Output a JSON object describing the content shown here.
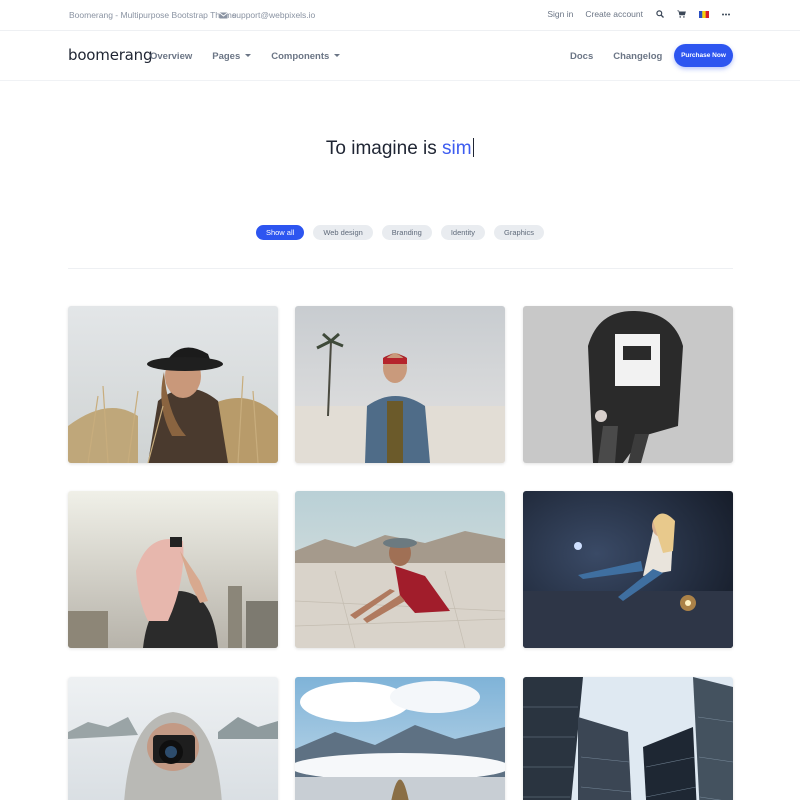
{
  "topbar": {
    "title": "Boomerang - Multipurpose Bootstrap Theme",
    "email": "support@webpixels.io",
    "sign_in": "Sign in",
    "create_account": "Create account",
    "icons": [
      "envelope-icon",
      "search-icon",
      "cart-icon",
      "flag-icon",
      "more-icon"
    ]
  },
  "navbar": {
    "brand": "boomerang",
    "left_items": [
      "Overview",
      "Pages",
      "Components"
    ],
    "right_items": [
      "Docs",
      "Changelog"
    ],
    "purchase_label": "Purchase Now",
    "accent_color": "#2d55f0"
  },
  "hero": {
    "text_prefix": "To imagine is ",
    "text_typed": "sim"
  },
  "filters": {
    "items": [
      "Show all",
      "Web design",
      "Branding",
      "Identity",
      "Graphics"
    ],
    "active": "Show all"
  },
  "gallery": {
    "images": [
      "woman-in-hat-photo",
      "man-on-beach-photo",
      "woman-in-black-sweater-photo",
      "woman-taking-photo-photo",
      "woman-sitting-desert-photo",
      "woman-with-sparkler-photo",
      "person-with-camera-photo",
      "hiker-in-mountains-photo",
      "skyscrapers-photo"
    ]
  }
}
